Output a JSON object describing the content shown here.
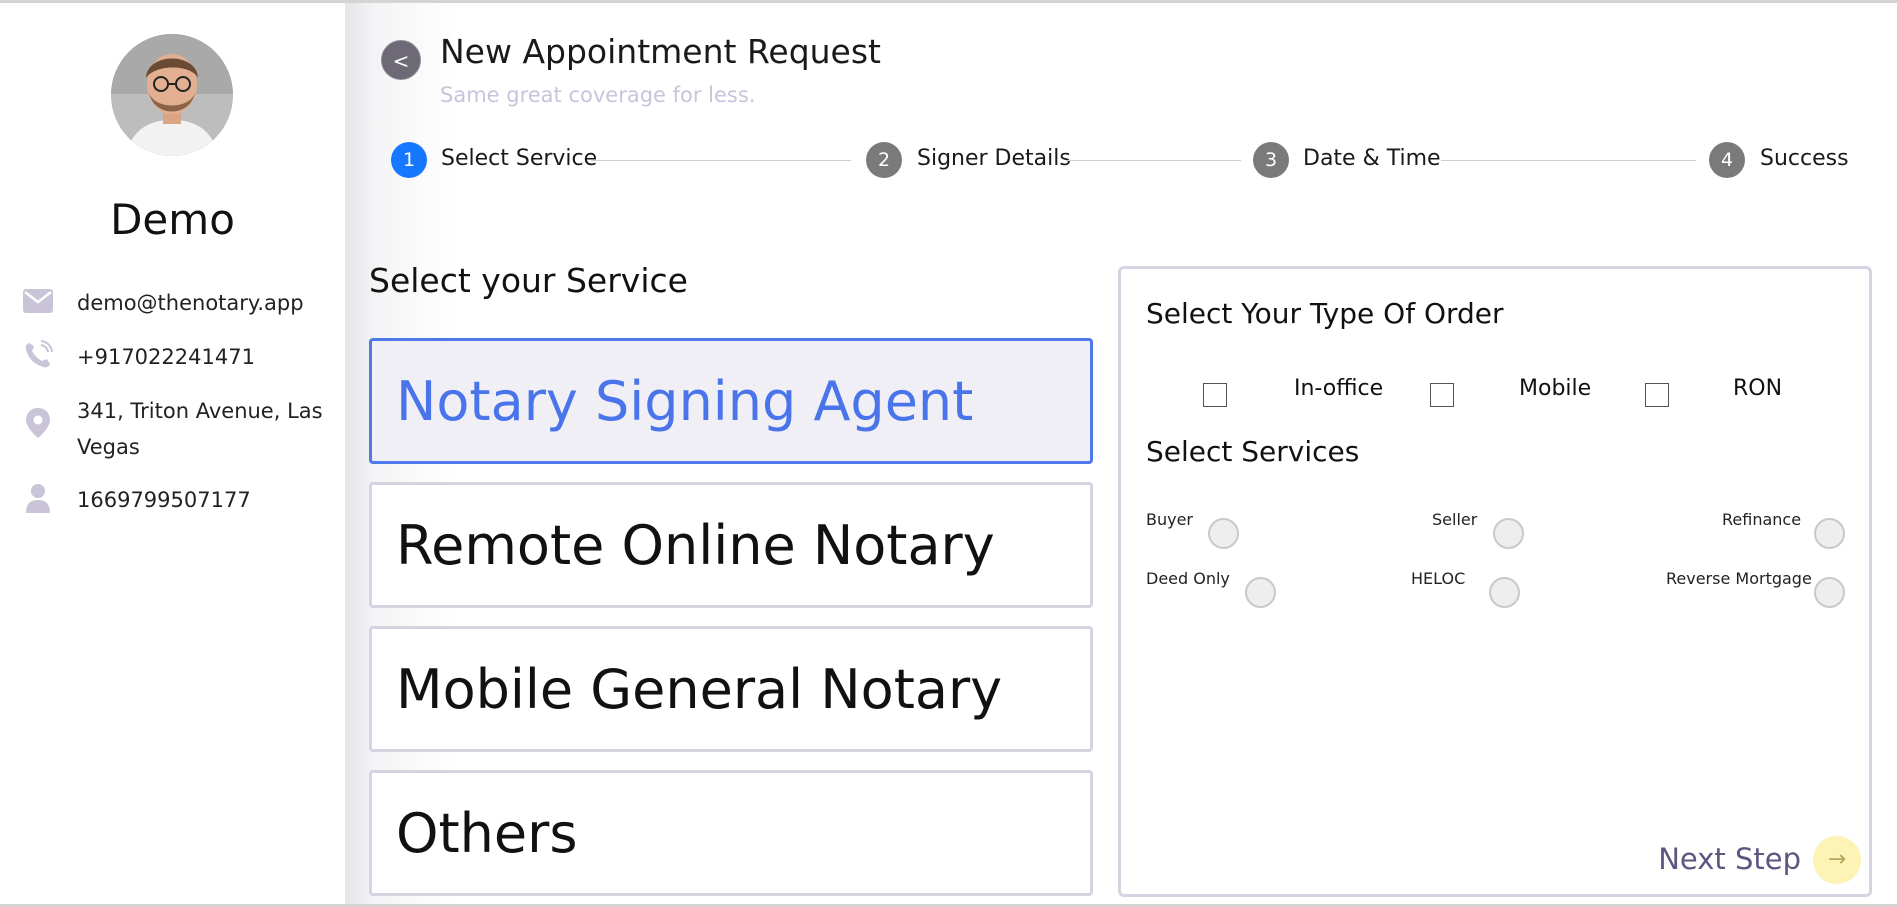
{
  "profile": {
    "name": "Demo",
    "email": "demo@thenotary.app",
    "phone": "+917022241471",
    "address_line1": "341, Triton Avenue, Las",
    "address_line2": "Vegas",
    "id": "1669799507177"
  },
  "header": {
    "back_label": "<",
    "title": "New Appointment Request",
    "subtitle": "Same great coverage for less."
  },
  "steps": [
    {
      "number": "1",
      "label": "Select Service"
    },
    {
      "number": "2",
      "label": "Signer Details"
    },
    {
      "number": "3",
      "label": "Date & Time"
    },
    {
      "number": "4",
      "label": "Success"
    }
  ],
  "service_section": {
    "title": "Select your Service",
    "options": [
      "Notary Signing Agent",
      "Remote Online Notary",
      "Mobile General Notary",
      "Others"
    ]
  },
  "order": {
    "type_title": "Select Your Type Of Order",
    "types": [
      "In-office",
      "Mobile",
      "RON"
    ],
    "services_title": "Select Services",
    "services": [
      "Buyer",
      "Seller",
      "Refinance",
      "Deed Only",
      "HELOC",
      "Reverse Mortgage"
    ],
    "next_label": "Next Step",
    "next_arrow": "→"
  },
  "colors": {
    "active_step": "#1677ff",
    "selected_card_border": "#4e79e8",
    "selected_card_text": "#4a74ea",
    "next_button_bg": "#fdf3b6"
  }
}
